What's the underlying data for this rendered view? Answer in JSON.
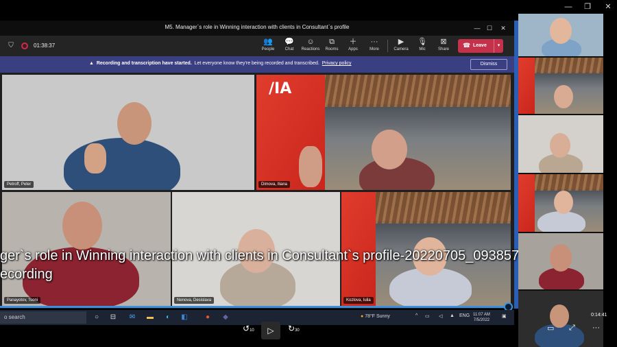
{
  "player": {
    "controls": [
      "—",
      "❐",
      "✕"
    ],
    "timecode": "0:14:41",
    "rewind_label": "10",
    "forward_label": "30"
  },
  "teams": {
    "title": "M5. Manager`s role in Winning interaction with clients in Consultant`s profile",
    "timer": "01:38:37",
    "toolbar": [
      {
        "label": "People",
        "icon": "people-icon"
      },
      {
        "label": "Chat",
        "icon": "chat-icon"
      },
      {
        "label": "Reactions",
        "icon": "reactions-icon"
      },
      {
        "label": "Rooms",
        "icon": "rooms-icon"
      },
      {
        "label": "Apps",
        "icon": "apps-icon"
      },
      {
        "label": "More",
        "icon": "more-icon"
      },
      {
        "label": "Camera",
        "icon": "camera-icon"
      },
      {
        "label": "Mic",
        "icon": "mic-icon"
      },
      {
        "label": "Share",
        "icon": "share-icon"
      }
    ],
    "leave_label": "Leave",
    "banner": {
      "bold": "Recording and transcription have started.",
      "text": "Let everyone know they're being recorded and transcribed.",
      "link": "Privacy policy",
      "dismiss": "Dismiss"
    },
    "participants": [
      {
        "name": "Petroff, Peter"
      },
      {
        "name": "Dimova, Iliana"
      },
      {
        "name": "Panayotov, Tsoni"
      },
      {
        "name": "Nenova, Desislava"
      },
      {
        "name": "Kozlova, Iulia"
      }
    ],
    "logo_text": "/IA"
  },
  "caption": {
    "line1": "ger`s role in Winning interaction with clients in Consultant`s profile-20220705_093857-",
    "line2": "ecording"
  },
  "taskbar": {
    "search_placeholder": "o search",
    "weather": "78°F  Sunny",
    "lang": "ENG",
    "time": "11:07 AM",
    "date": "7/5/2022"
  },
  "colors": {
    "accent_blue": "#3b8fdc",
    "leave_red": "#c4314b",
    "banner_purple": "#3a3f82"
  }
}
